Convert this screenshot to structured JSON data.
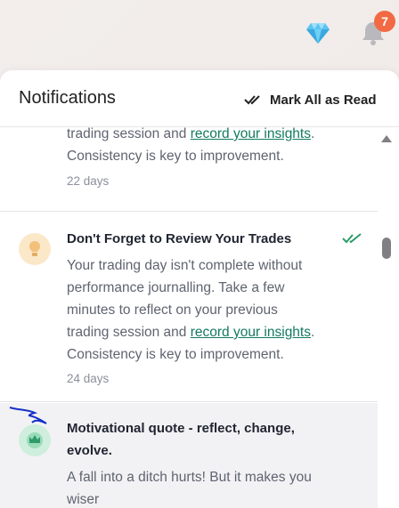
{
  "topbar": {
    "gem_icon": "diamond-icon",
    "bell_icon": "bell-icon",
    "notification_count": "7"
  },
  "panel": {
    "title": "Notifications",
    "mark_all_label": "Mark All as Read",
    "mark_all_icon": "double-check-icon"
  },
  "notifications": [
    {
      "body_before": "trading session and ",
      "link": "record your insights",
      "body_after_link": ".",
      "body_line2": "Consistency is key to improvement.",
      "time": "22 days"
    },
    {
      "icon": "bulb-icon",
      "title": "Don't Forget to Review Your Trades",
      "body_lines": [
        "Your trading day isn't complete without",
        "performance journalling. Take a few",
        "minutes to reflect on your previous"
      ],
      "body_before": "trading session and ",
      "link": "record your insights",
      "body_after_link": ".",
      "body_line2": "Consistency is key to improvement.",
      "time": "24 days",
      "read_icon": "double-check-icon"
    },
    {
      "icon": "crown-icon",
      "title": "Motivational quote - reflect, change, evolve.",
      "body": "A fall into a ditch hurts! But it makes you wiser"
    }
  ],
  "colors": {
    "accent_green": "#127a5e",
    "badge": "#f26a43",
    "check_green": "#2f9a6c"
  }
}
